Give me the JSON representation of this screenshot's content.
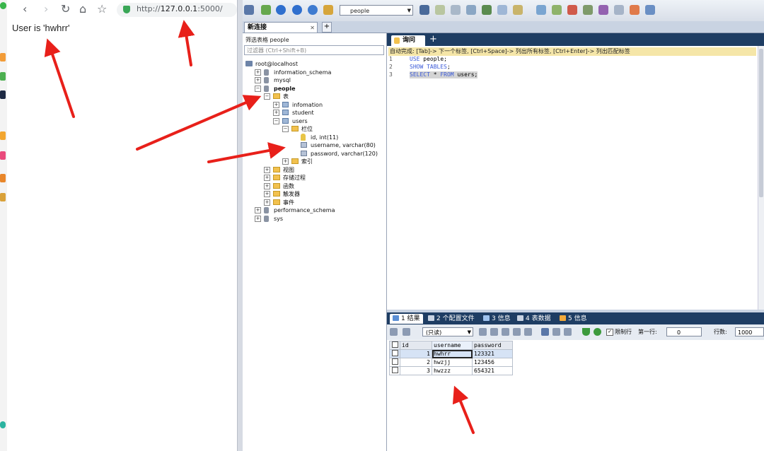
{
  "browser": {
    "url_prefix": "http://",
    "url_host": "127.0.0.1",
    "url_rest": ":5000/",
    "page_text": "User is 'hwhrr'",
    "nav_icons": [
      "back-icon",
      "forward-icon",
      "reload-icon",
      "home-icon",
      "star-icon"
    ]
  },
  "sqlyog": {
    "db_selector": "people",
    "object_tab": "新连接",
    "object_browser": {
      "filter_label": "筛选表格 people",
      "filter_placeholder": "过滤器 (Ctrl+Shift+B)",
      "tree": [
        {
          "label": "root@localhost",
          "icon": "server-icon",
          "indent": 0,
          "expander": ""
        },
        {
          "label": "information_schema",
          "icon": "database-icon",
          "indent": 1,
          "expander": "+"
        },
        {
          "label": "mysql",
          "icon": "database-icon",
          "indent": 1,
          "expander": "+"
        },
        {
          "label": "people",
          "icon": "database-icon",
          "indent": 1,
          "expander": "-",
          "bold": true
        },
        {
          "label": "表",
          "icon": "folder-icon",
          "indent": 2,
          "expander": "-"
        },
        {
          "label": "infomation",
          "icon": "table-icon",
          "indent": 3,
          "expander": "+"
        },
        {
          "label": "student",
          "icon": "table-icon",
          "indent": 3,
          "expander": "+"
        },
        {
          "label": "users",
          "icon": "table-icon",
          "indent": 3,
          "expander": "-"
        },
        {
          "label": "栏位",
          "icon": "folder-icon",
          "indent": 4,
          "expander": "-"
        },
        {
          "label": "id, int(11)",
          "icon": "key-icon",
          "indent": 5,
          "expander": ""
        },
        {
          "label": "username, varchar(80)",
          "icon": "column-icon",
          "indent": 5,
          "expander": ""
        },
        {
          "label": "password, varchar(120)",
          "icon": "column-icon",
          "indent": 5,
          "expander": ""
        },
        {
          "label": "索引",
          "icon": "folder-icon",
          "indent": 4,
          "expander": "+"
        },
        {
          "label": "视图",
          "icon": "folder-icon",
          "indent": 2,
          "expander": "+"
        },
        {
          "label": "存储过程",
          "icon": "folder-icon",
          "indent": 2,
          "expander": "+"
        },
        {
          "label": "函数",
          "icon": "folder-icon",
          "indent": 2,
          "expander": "+"
        },
        {
          "label": "触发器",
          "icon": "folder-icon",
          "indent": 2,
          "expander": "+"
        },
        {
          "label": "事件",
          "icon": "folder-icon",
          "indent": 2,
          "expander": "+"
        },
        {
          "label": "performance_schema",
          "icon": "database-icon",
          "indent": 1,
          "expander": "+"
        },
        {
          "label": "sys",
          "icon": "database-icon",
          "indent": 1,
          "expander": "+"
        }
      ]
    },
    "query": {
      "tab_label": "询问",
      "autocomplete_hint": "自动完成: [Tab]-> 下一个标签, [Ctrl+Space]-> 列出所有标签, [Ctrl+Enter]-> 列出匹配标签",
      "lines": [
        {
          "n": "1",
          "kw": "USE",
          "rest": " people;"
        },
        {
          "n": "2",
          "kw": "SHOW TABLES",
          "rest": ";"
        },
        {
          "n": "3",
          "kw": "SELECT",
          "rest": " * ",
          "kw2": "FROM",
          "rest2": " users;"
        }
      ]
    },
    "results": {
      "tabs": [
        {
          "label": "1 结果",
          "icon_color": "#5b8fd6"
        },
        {
          "label": "2 个配置文件",
          "icon_color": "#c9d3e2"
        },
        {
          "label": "3 信息",
          "icon_color": "#9fc3ef"
        },
        {
          "label": "4 表数据",
          "icon_color": "#c9d3e2"
        },
        {
          "label": "5 信息",
          "icon_color": "#f2a93b"
        }
      ],
      "readonly_select": "(只读)",
      "limit_label": "限制行",
      "first_row_label": "第一行:",
      "first_row_value": "0",
      "rows_label": "行数:",
      "rows_value": "1000",
      "columns": [
        "id",
        "username",
        "password"
      ],
      "rows": [
        {
          "id": "1",
          "username": "hwhrr",
          "password": "123321"
        },
        {
          "id": "2",
          "username": "hwzjj",
          "password": "123456"
        },
        {
          "id": "3",
          "username": "hwzzz",
          "password": "654321"
        }
      ]
    }
  },
  "colors": {
    "arrow": "#e8201a",
    "dark_tab_bar": "#1e3d63",
    "autocomplete_bg": "#f5e6a8",
    "keyword": "#3b5ad8"
  }
}
